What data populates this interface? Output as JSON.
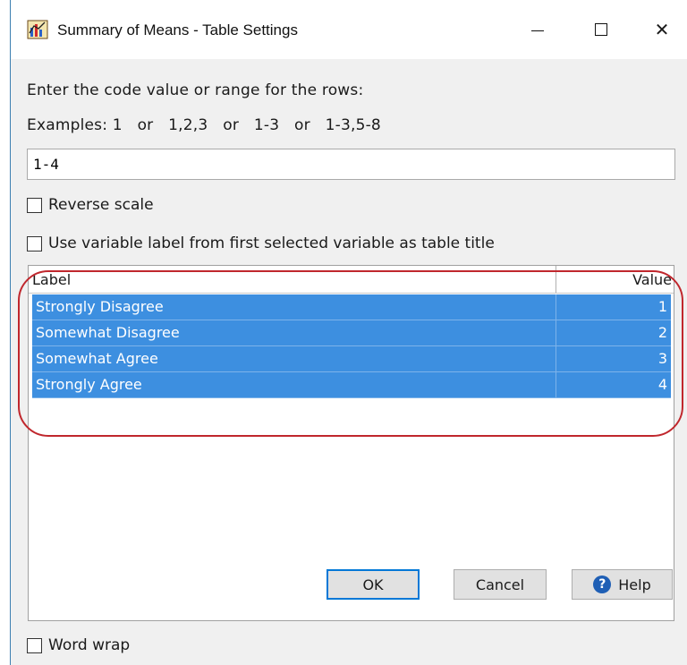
{
  "window": {
    "title": "Summary of Means - Table Settings",
    "app_icon": "graph-app-icon",
    "controls": {
      "minimize": "minimize-icon",
      "maximize": "maximize-icon",
      "close": "close-icon",
      "close_glyph": "✕"
    }
  },
  "form": {
    "prompt": "Enter the code value or range for the rows:",
    "examples": "Examples: 1   or   1,2,3   or   1-3   or   1-3,5-8",
    "range_value": "1-4",
    "reverse_scale_label": "Reverse scale",
    "reverse_scale_checked": false,
    "use_label_title": "Use variable label from first selected variable as table title",
    "use_label_title_checked": false
  },
  "table": {
    "headers": {
      "label": "Label",
      "value": "Value"
    },
    "rows": [
      {
        "label": "Strongly Disagree",
        "value": "1"
      },
      {
        "label": "Somewhat Disagree",
        "value": "2"
      },
      {
        "label": "Somewhat Agree",
        "value": "3"
      },
      {
        "label": "Strongly Agree",
        "value": "4"
      }
    ],
    "selection_color": "#3d8fe0",
    "highlight_color": "#c0272d"
  },
  "footer": {
    "word_wrap_label": "Word wrap",
    "word_wrap_checked": false,
    "ok": "OK",
    "cancel": "Cancel",
    "help": "Help",
    "help_glyph": "?"
  }
}
